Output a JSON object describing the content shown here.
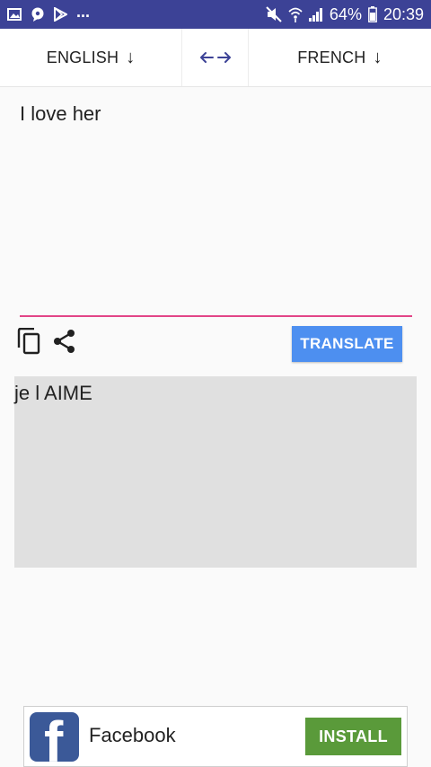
{
  "status_bar": {
    "overflow": "...",
    "battery": "64%",
    "time": "20:39",
    "icons": [
      "gallery-icon",
      "chat-icon",
      "play-store-icon",
      "mute-icon",
      "wifi-icon",
      "signal-icon",
      "battery-icon"
    ]
  },
  "language_bar": {
    "source": "ENGLISH",
    "source_arrow": "↓",
    "swap": "↔",
    "target": "FRENCH",
    "target_arrow": "↓"
  },
  "input": {
    "value": "I love her"
  },
  "toolbar": {
    "copy_icon": "copy-icon",
    "share_icon": "share-icon",
    "translate_label": "TRANSLATE"
  },
  "output": {
    "value": "je l AIME"
  },
  "ad": {
    "logo_letter": "f",
    "title": "Facebook",
    "install_label": "INSTALL"
  },
  "colors": {
    "status_bar": "#3c4296",
    "accent_underline": "#e24587",
    "translate_button": "#4d8ff0",
    "output_background": "#e0e0e0",
    "install_button": "#5a9a3a",
    "facebook_blue": "#3b5998"
  }
}
